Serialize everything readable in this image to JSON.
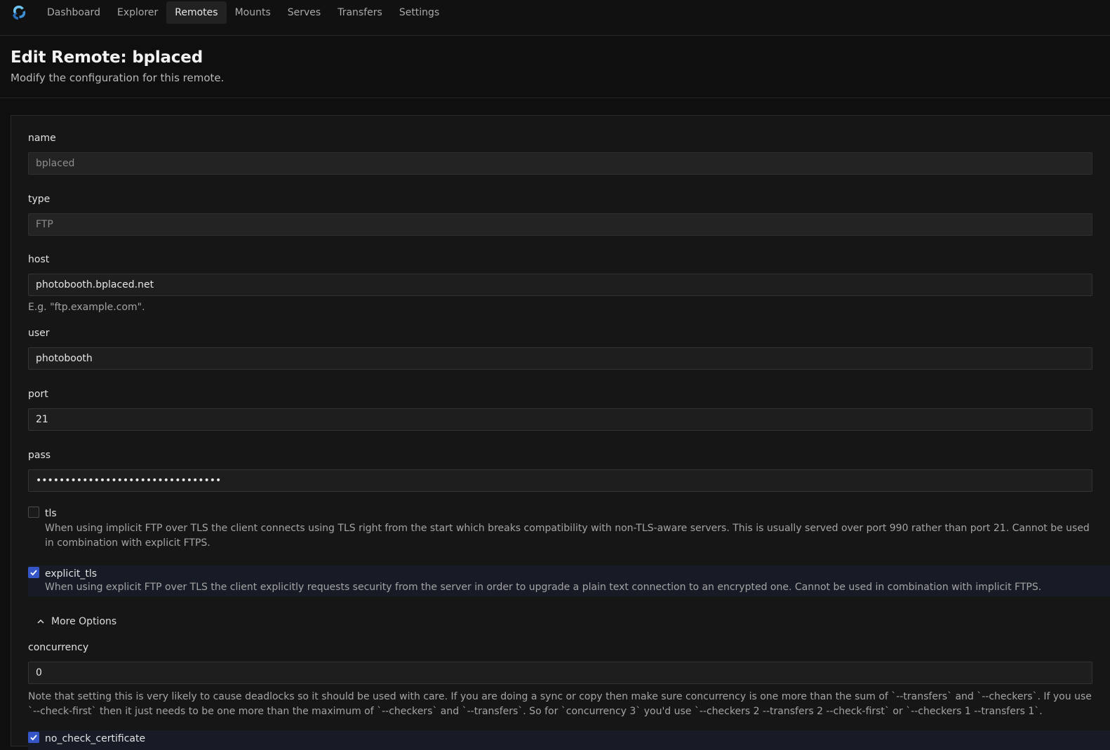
{
  "nav": {
    "items": [
      {
        "label": "Dashboard",
        "active": false
      },
      {
        "label": "Explorer",
        "active": false
      },
      {
        "label": "Remotes",
        "active": true
      },
      {
        "label": "Mounts",
        "active": false
      },
      {
        "label": "Serves",
        "active": false
      },
      {
        "label": "Transfers",
        "active": false
      },
      {
        "label": "Settings",
        "active": false
      }
    ],
    "logo_icon": "rclone-logo-icon",
    "accent": "#3d8fd6"
  },
  "header": {
    "title": "Edit Remote: bplaced",
    "subtitle": "Modify the configuration for this remote."
  },
  "form": {
    "name": {
      "label": "name",
      "value": "bplaced"
    },
    "type": {
      "label": "type",
      "value": "FTP"
    },
    "host": {
      "label": "host",
      "value": "photobooth.bplaced.net",
      "hint": "E.g. \"ftp.example.com\"."
    },
    "user": {
      "label": "user",
      "value": "photobooth"
    },
    "port": {
      "label": "port",
      "value": "21"
    },
    "pass": {
      "label": "pass",
      "value": "••••••••••••••••••••••••••••••••"
    },
    "tls": {
      "label": "tls",
      "checked": false,
      "description": "When using implicit FTP over TLS the client connects using TLS right from the start which breaks compatibility with non-TLS-aware servers. This is usually served over port 990 rather than port 21. Cannot be used in combination with explicit FTPS."
    },
    "explicit_tls": {
      "label": "explicit_tls",
      "checked": true,
      "description": "When using explicit FTP over TLS the client explicitly requests security from the server in order to upgrade a plain text connection to an encrypted one. Cannot be used in combination with implicit FTPS."
    },
    "more_options": {
      "label": "More Options",
      "icon": "chevron-up-icon"
    },
    "concurrency": {
      "label": "concurrency",
      "value": "0",
      "hint": "Note that setting this is very likely to cause deadlocks so it should be used with care. If you are doing a sync or copy then make sure concurrency is one more than the sum of `--transfers` and `--checkers`. If you use `--check-first` then it just needs to be one more than the maximum of `--checkers` and `--transfers`. So for `concurrency 3` you'd use `--checkers 2 --transfers 2 --check-first` or `--checkers 1 --transfers 1`."
    },
    "no_check_certificate": {
      "label": "no_check_certificate",
      "checked": true
    }
  },
  "colors": {
    "background": "#0f0f0f",
    "panel": "#161616",
    "input": "#1e1e1e",
    "checkbox_checked": "#3656c8",
    "checked_row_highlight": "#171b26"
  }
}
